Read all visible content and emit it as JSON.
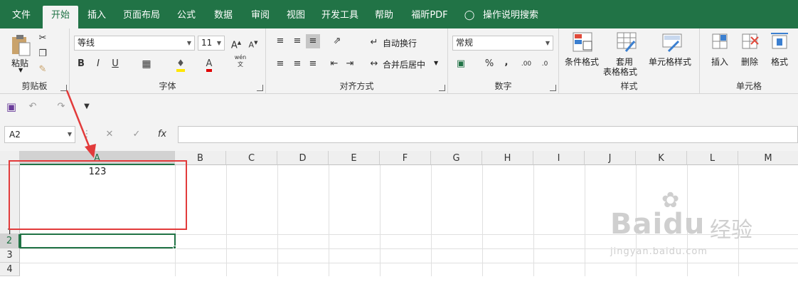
{
  "tabs": [
    {
      "label": "文件"
    },
    {
      "label": "开始"
    },
    {
      "label": "插入"
    },
    {
      "label": "页面布局"
    },
    {
      "label": "公式"
    },
    {
      "label": "数据"
    },
    {
      "label": "审阅"
    },
    {
      "label": "视图"
    },
    {
      "label": "开发工具"
    },
    {
      "label": "帮助"
    },
    {
      "label": "福昕PDF"
    },
    {
      "label": "操作说明搜索"
    }
  ],
  "clipboard": {
    "paste": "粘贴",
    "group": "剪贴板"
  },
  "font": {
    "name": "等线",
    "size": "11",
    "group": "字体",
    "bold": "B",
    "italic": "I",
    "underline": "U",
    "wen": "wén\n文"
  },
  "align": {
    "wrap": "自动换行",
    "merge": "合并后居中",
    "group": "对齐方式"
  },
  "number": {
    "format": "常规",
    "pct": "%",
    "comma": ",",
    "group": "数字",
    "inc": ".00",
    "dec": ".0"
  },
  "styles": {
    "cond": "条件格式",
    "table1": "套用",
    "table2": "表格格式",
    "cell": "单元格样式",
    "group": "样式"
  },
  "cells": {
    "insert": "插入",
    "delete": "删除",
    "format": "格式",
    "group": "单元格"
  },
  "formula_bar": {
    "name_box": "A2",
    "fx": "fx",
    "value": ""
  },
  "columns": [
    "A",
    "B",
    "C",
    "D",
    "E",
    "F",
    "G",
    "H",
    "I",
    "J",
    "K",
    "L",
    "M"
  ],
  "rows": [
    "1",
    "2",
    "3",
    "4"
  ],
  "cell_a1": "123",
  "watermark": {
    "brand": "Baidu",
    "cn": "经验",
    "url": "jingyan.baidu.com"
  },
  "accent": "#217346",
  "annotation_color": "#e23b3b"
}
